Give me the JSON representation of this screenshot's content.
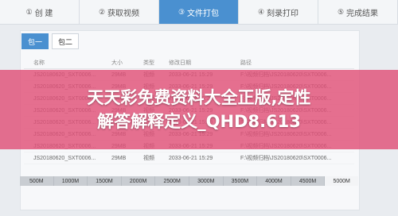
{
  "wizard": {
    "steps": [
      {
        "num": "①",
        "label": "创 建"
      },
      {
        "num": "②",
        "label": "获取视频"
      },
      {
        "num": "③",
        "label": "文件打包"
      },
      {
        "num": "④",
        "label": "刻录打印"
      },
      {
        "num": "⑤",
        "label": "完成结果"
      }
    ]
  },
  "packages": [
    "包一",
    "包二"
  ],
  "table": {
    "headers": [
      "名称",
      "大小",
      "类型",
      "修改日期",
      "路径"
    ],
    "rows": [
      {
        "name": "JS20180620_SXT0006...",
        "size": "29MB",
        "type": "视频",
        "date": "2033-06-21 15:29",
        "path": "F:\\视频归档\\JS20180620\\SXT0006..."
      },
      {
        "name": "JS20180620_SXT0006...",
        "size": "29MB",
        "type": "视频",
        "date": "2033-06-21 15:29",
        "path": "F:\\视频归档\\JS20180620\\SXT0006..."
      },
      {
        "name": "JS20180620_SXT0006...",
        "size": "29MB",
        "type": "视频",
        "date": "2033-06-21 15:29",
        "path": "F:\\视频归档\\JS20180620\\SXT0006..."
      },
      {
        "name": "JS20180620_SXT0006...",
        "size": "29MB",
        "type": "视频",
        "date": "2033-06-21 15:29",
        "path": "F:\\视频归档\\JS20180620\\SXT0006..."
      },
      {
        "name": "JS20180620_SXT0006...",
        "size": "29MB",
        "type": "视频",
        "date": "2033-06-21 15:29",
        "path": "F:\\视频归档\\JS20180620\\SXT0006..."
      },
      {
        "name": "JS20180620_SXT0006...",
        "size": "29MB",
        "type": "视频",
        "date": "2033-06-21 15:29",
        "path": "F:\\视频归档\\JS20180620\\SXT0006..."
      },
      {
        "name": "JS20180620_SXT0006...",
        "size": "29MB",
        "type": "视频",
        "date": "2033-06-21 15:29",
        "path": "F:\\视频归档\\JS20180620\\SXT0006..."
      },
      {
        "name": "JS20180620_SXT0006...",
        "size": "29MB",
        "type": "视频",
        "date": "2033-06-21 15:29",
        "path": "F:\\视频归档\\JS20180620\\SXT0006..."
      }
    ]
  },
  "sizebar": [
    "500M",
    "1000M",
    "1500M",
    "2000M",
    "2500M",
    "3000M",
    "3500M",
    "4000M",
    "4500M",
    "5000M"
  ],
  "overlay": {
    "line1": "天天彩免费资料大全正版,定性",
    "line2": "解答解释定义_QHD8.613"
  }
}
